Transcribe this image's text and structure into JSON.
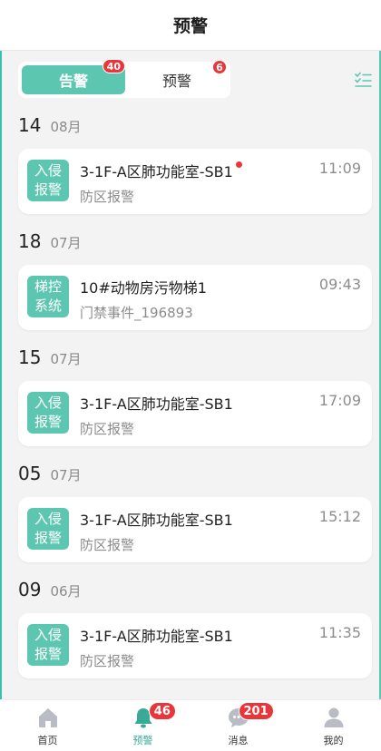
{
  "header": {
    "title": "预警"
  },
  "tabs": [
    {
      "label": "告警",
      "count": "40",
      "active": true
    },
    {
      "label": "预警",
      "count": "6",
      "active": false
    }
  ],
  "filter": {
    "icon": "list-check-icon"
  },
  "groups": [
    {
      "day": "14",
      "month": "08月",
      "card": {
        "category_line1": "入侵",
        "category_line2": "报警",
        "name": "3-1F-A区肺功能室-SB1",
        "unread": true,
        "desc": "防区报警",
        "time": "11:09"
      }
    },
    {
      "day": "18",
      "month": "07月",
      "card": {
        "category_line1": "梯控",
        "category_line2": "系统",
        "name": "10#动物房污物梯1",
        "unread": false,
        "desc": "门禁事件_196893",
        "time": "09:43"
      }
    },
    {
      "day": "15",
      "month": "07月",
      "card": {
        "category_line1": "入侵",
        "category_line2": "报警",
        "name": "3-1F-A区肺功能室-SB1",
        "unread": false,
        "desc": "防区报警",
        "time": "17:09"
      }
    },
    {
      "day": "05",
      "month": "07月",
      "card": {
        "category_line1": "入侵",
        "category_line2": "报警",
        "name": "3-1F-A区肺功能室-SB1",
        "unread": false,
        "desc": "防区报警",
        "time": "15:12"
      }
    },
    {
      "day": "09",
      "month": "06月",
      "card": {
        "category_line1": "入侵",
        "category_line2": "报警",
        "name": "3-1F-A区肺功能室-SB1",
        "unread": false,
        "desc": "防区报警",
        "time": "11:35"
      }
    }
  ],
  "tabbar": [
    {
      "label": "首页",
      "icon": "home-icon",
      "badge": "",
      "active": false
    },
    {
      "label": "预警",
      "icon": "bell-icon",
      "badge": "46",
      "active": true
    },
    {
      "label": "消息",
      "icon": "chat-icon",
      "badge": "201",
      "active": false
    },
    {
      "label": "我的",
      "icon": "user-icon",
      "badge": "",
      "active": false
    }
  ],
  "colors": {
    "accent": "#5dc6b1",
    "badge": "#e8363a",
    "background": "#f3f3f3"
  }
}
